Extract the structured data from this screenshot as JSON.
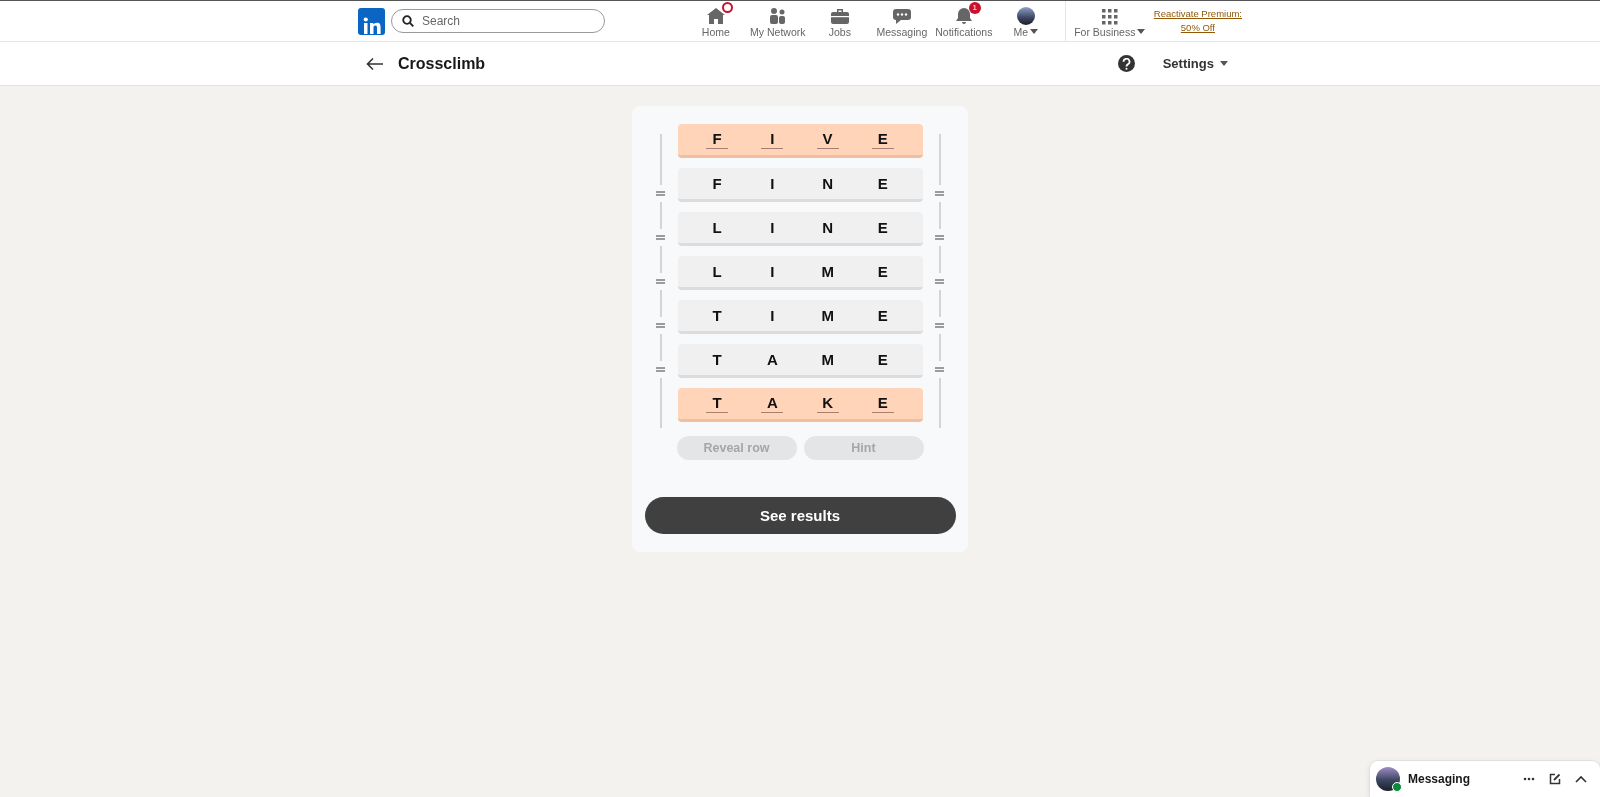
{
  "nav": {
    "search": {
      "placeholder": "Search"
    },
    "items": [
      {
        "label": "Home",
        "has_dot": true
      },
      {
        "label": "My Network"
      },
      {
        "label": "Jobs"
      },
      {
        "label": "Messaging"
      },
      {
        "label": "Notifications",
        "badge": "1"
      },
      {
        "label": "Me",
        "dropdown": true
      }
    ],
    "business": {
      "label": "For Business"
    },
    "premium_link": [
      "Reactivate Premium:",
      "50% Off"
    ]
  },
  "subheader": {
    "title": "Crossclimb",
    "settings": "Settings"
  },
  "rows": [
    {
      "kind": "locked",
      "letters": [
        "F",
        "I",
        "V",
        "E"
      ]
    },
    {
      "kind": "movable",
      "letters": [
        "F",
        "I",
        "N",
        "E"
      ]
    },
    {
      "kind": "movable",
      "letters": [
        "L",
        "I",
        "N",
        "E"
      ]
    },
    {
      "kind": "movable",
      "letters": [
        "L",
        "I",
        "M",
        "E"
      ]
    },
    {
      "kind": "movable",
      "letters": [
        "T",
        "I",
        "M",
        "E"
      ]
    },
    {
      "kind": "movable",
      "letters": [
        "T",
        "A",
        "M",
        "E"
      ]
    },
    {
      "kind": "locked",
      "letters": [
        "T",
        "A",
        "K",
        "E"
      ]
    }
  ],
  "actions": [
    {
      "label": "Reveal row",
      "disabled": true
    },
    {
      "label": "Hint",
      "disabled": true
    }
  ],
  "results_button": "See results",
  "messaging_dock": {
    "title": "Messaging",
    "online": true
  }
}
